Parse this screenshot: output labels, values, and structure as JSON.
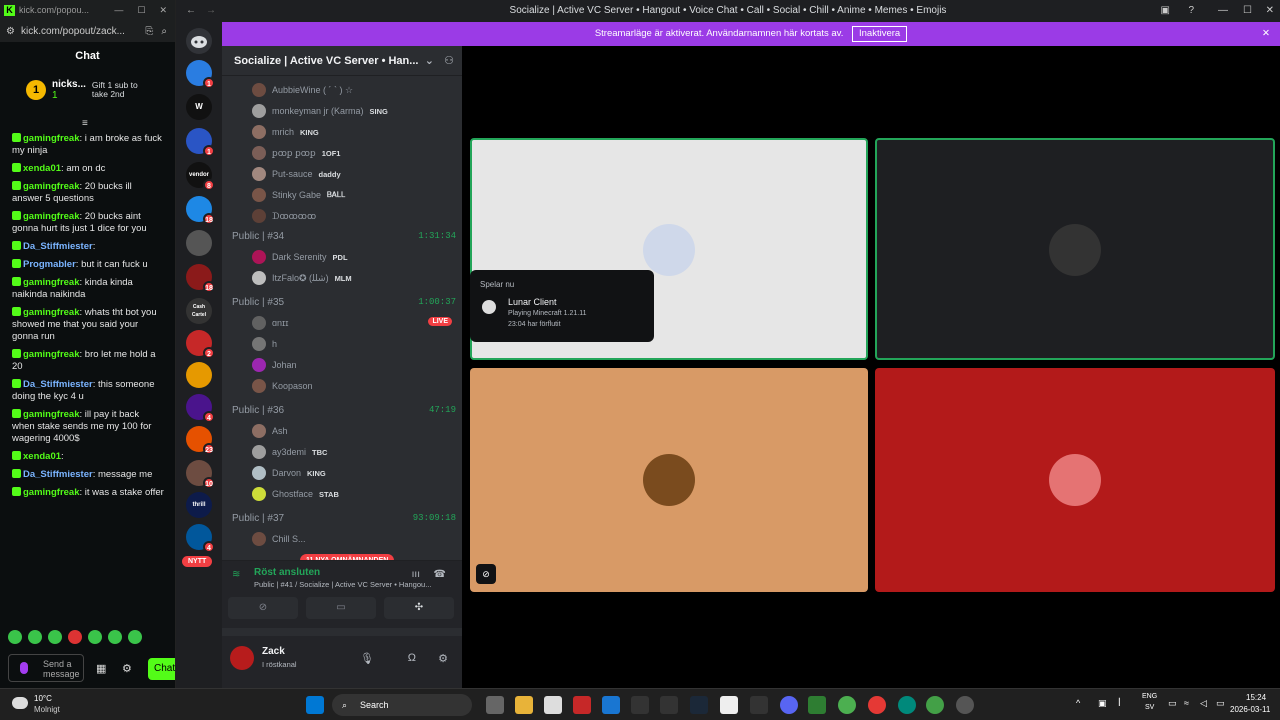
{
  "kick": {
    "tab_url": "kick.com/popou...",
    "url": "kick.com/popout/zack...",
    "chat_title": "Chat",
    "pinned_user": "nicks...",
    "pinned_count": "1",
    "pinned_rank": "1",
    "gift_text": "Gift 1 sub to take 2nd",
    "messages": [
      {
        "user": "gamingfreak",
        "text": "i am broke as fuck my ninja",
        "color": "#53fc18"
      },
      {
        "user": "xenda01",
        "text": "am on dc",
        "color": "#53fc18"
      },
      {
        "user": "gamingfreak",
        "text": "20 bucks ill answer 5 questions",
        "color": "#53fc18"
      },
      {
        "user": "gamingfreak",
        "text": "20 bucks aint gonna hurt its just 1 dice for you",
        "color": "#53fc18"
      },
      {
        "user": "Da_Stiffmiester",
        "text": "",
        "color": "#7ab4ff"
      },
      {
        "user": "Progmabler",
        "text": "but it can fuck u",
        "color": "#7ab4ff"
      },
      {
        "user": "gamingfreak",
        "text": "kinda kinda naikinda naikinda",
        "color": "#53fc18"
      },
      {
        "user": "gamingfreak",
        "text": "whats tht bot you showed me that you said your gonna run",
        "color": "#53fc18"
      },
      {
        "user": "gamingfreak",
        "text": "bro let me hold a 20",
        "color": "#53fc18"
      },
      {
        "user": "Da_Stiffmiester",
        "text": "this someone doing the kyc 4 u",
        "color": "#7ab4ff"
      },
      {
        "user": "gamingfreak",
        "text": "ill pay it back when stake sends me my 100 for wagering 4000$",
        "color": "#53fc18"
      },
      {
        "user": "xenda01",
        "text": "",
        "color": "#53fc18"
      },
      {
        "user": "Da_Stiffmiester",
        "text": "message me",
        "color": "#7ab4ff"
      },
      {
        "user": "gamingfreak",
        "text": "it was a stake offer",
        "color": "#53fc18"
      }
    ],
    "send_placeholder": "Send a message",
    "chat_button": "Chat"
  },
  "discord": {
    "window_title": "Socialize | Active VC Server • Hangout • Voice Chat • Call • Social • Chill • Anime • Memes • Emojis",
    "banner_text": "Streamarläge är aktiverat. Användarnamnen här kortats av.",
    "banner_button": "Inaktivera",
    "server_name": "Socialize | Active VC Server • Han...",
    "guild_badges": [
      "1",
      "1",
      "8",
      "18",
      "18",
      "2",
      "4",
      "23",
      "10",
      "4"
    ],
    "guild_labels": [
      "W",
      "vendor",
      "Cash Cartel",
      "thrill"
    ],
    "members_top": [
      {
        "name": "AubbieWine ( ´ ` ) ☆",
        "tag": ""
      },
      {
        "name": "monkeyman jr (Karma)",
        "tag": "SING"
      },
      {
        "name": "mrich",
        "tag": "KING"
      },
      {
        "name": "ꝑꝏꝑ ꝑꝏꝑ",
        "tag": "1OF1"
      },
      {
        "name": "Put-sauce",
        "tag": "daddy"
      },
      {
        "name": "Stinky Gabe",
        "tag": "ᏴᎪᏞᏞ"
      },
      {
        "name": "ᗪꝏꝏꝏꝏ",
        "tag": ""
      }
    ],
    "channels": [
      {
        "name": "Public | #34",
        "time": "1:31:34",
        "members": [
          {
            "name": "Dark Serenity",
            "tag": "PDL"
          },
          {
            "name": "ItzFalo✪ (ﺷﻠﻠ)",
            "tag": "MLM"
          }
        ]
      },
      {
        "name": "Public | #35",
        "time": "1:00:37",
        "members": [
          {
            "name": "ɑnɪɪ",
            "tag": ""
          },
          {
            "name": "h",
            "tag": ""
          },
          {
            "name": "Johan",
            "tag": ""
          },
          {
            "name": "Koopason",
            "tag": ""
          }
        ]
      },
      {
        "name": "Public | #36",
        "time": "47:19",
        "members": [
          {
            "name": "Ash",
            "tag": ""
          },
          {
            "name": "ay3demi",
            "tag": "TBC"
          },
          {
            "name": "Darvon",
            "tag": "KING"
          },
          {
            "name": "Ghostface",
            "tag": "STAB"
          }
        ]
      },
      {
        "name": "Public | #37",
        "time": "93:09:18",
        "members": [
          {
            "name": "Chill S...",
            "tag": ""
          }
        ]
      }
    ],
    "live_label": "LIVE",
    "new_label": "NYTT",
    "new_mentions": "11 NYA OMNÄMNANDEN",
    "voice_status": "Röst ansluten",
    "voice_channel": "Public | #41 / Socialize | Active VC Server • Hangou...",
    "user_name": "Zack",
    "user_status": "I röstkanal",
    "popup": {
      "header": "Spelar nu",
      "game": "Lunar Client",
      "detail": "Playing Minecraft 1.21.11",
      "duration": "23:04 har förflutit"
    },
    "tile_colors": [
      "#e6e6e6",
      "#1e1f22",
      "#d89a66",
      "#b31a1a"
    ]
  },
  "taskbar": {
    "weather_temp": "10°C",
    "weather_desc": "Molnigt",
    "search": "Search",
    "lang1": "ENG",
    "lang2": "SV",
    "time": "15:24",
    "date": "2026-03-11"
  }
}
